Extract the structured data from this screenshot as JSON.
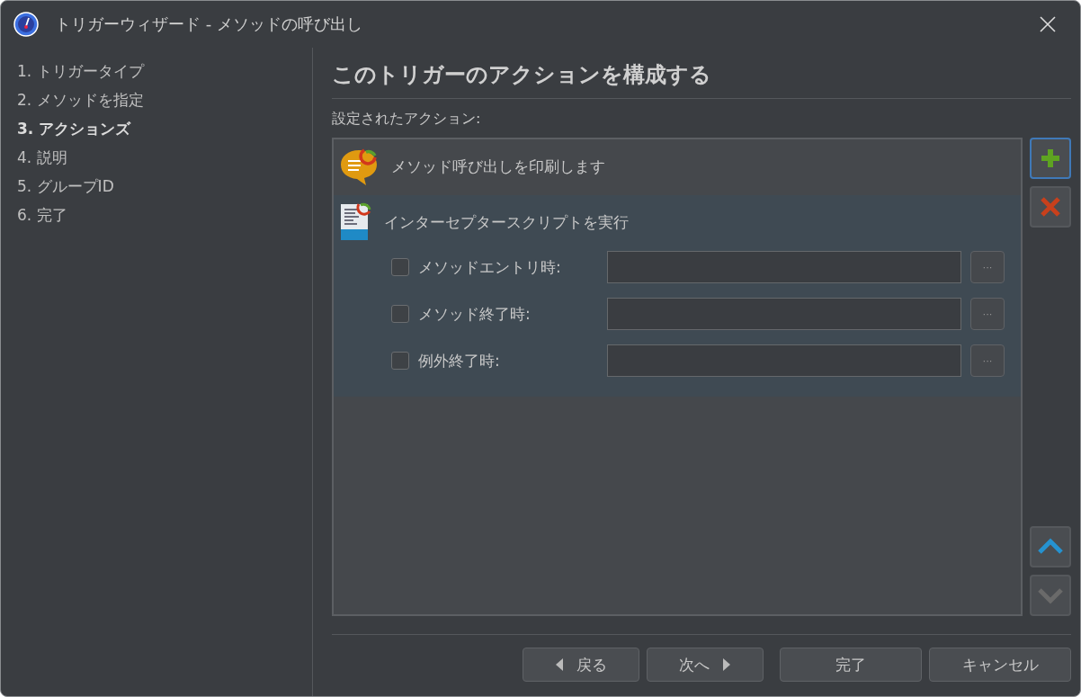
{
  "window": {
    "title": "トリガーウィザード - メソッドの呼び出し"
  },
  "steps": [
    {
      "label": "1. トリガータイプ",
      "selected": false
    },
    {
      "label": "2. メソッドを指定",
      "selected": false
    },
    {
      "label": "3. アクションズ",
      "selected": true
    },
    {
      "label": "4. 説明",
      "selected": false
    },
    {
      "label": "5. グループID",
      "selected": false
    },
    {
      "label": "6. 完了",
      "selected": false
    }
  ],
  "heading": "このトリガーのアクションを構成する",
  "actions_label": "設定されたアクション:",
  "actions": [
    {
      "kind": "print",
      "label": "メソッド呼び出しを印刷します",
      "selected": false
    },
    {
      "kind": "script",
      "label": "インターセプタースクリプトを実行",
      "selected": true,
      "options": [
        {
          "label": "メソッドエントリ時:",
          "checked": false,
          "browse": "···"
        },
        {
          "label": "メソッド終了時:",
          "checked": false,
          "browse": "···"
        },
        {
          "label": "例外終了時:",
          "checked": false,
          "browse": "···"
        }
      ]
    }
  ],
  "tool_buttons": [
    {
      "kind": "add",
      "focused": true,
      "disabled": false
    },
    {
      "kind": "remove",
      "focused": false,
      "disabled": false
    },
    {
      "kind": "up",
      "focused": false,
      "disabled": false
    },
    {
      "kind": "down",
      "focused": false,
      "disabled": true
    }
  ],
  "buttons": [
    {
      "kind": "back",
      "label": "戻る"
    },
    {
      "kind": "next",
      "label": "次へ"
    },
    {
      "kind": "finish",
      "label": "完了"
    },
    {
      "kind": "cancel",
      "label": "キャンセル"
    }
  ]
}
